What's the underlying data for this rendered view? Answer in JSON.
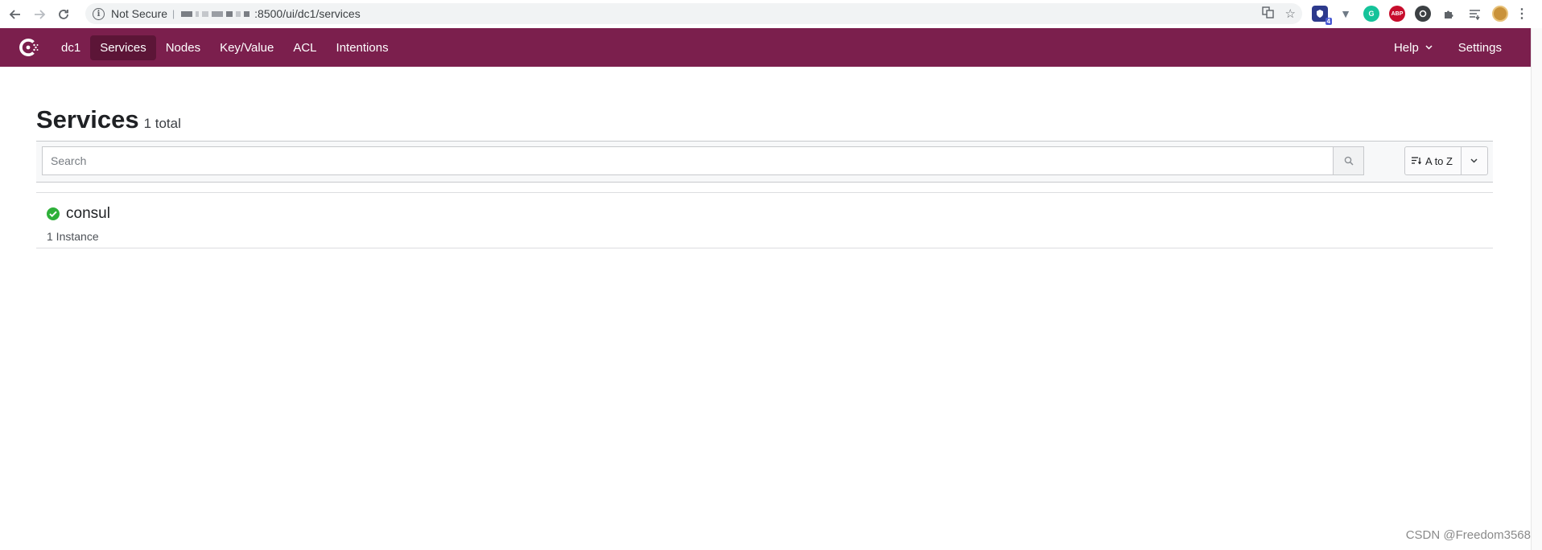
{
  "browser": {
    "security_label": "Not Secure",
    "url_suffix": ":8500/ui/dc1/services",
    "extensions_badge": "4",
    "extension_labels": {
      "grammarly": "G",
      "adblock": "ABP"
    }
  },
  "header": {
    "datacenter": "dc1",
    "nav": [
      {
        "label": "Services",
        "active": true
      },
      {
        "label": "Nodes",
        "active": false
      },
      {
        "label": "Key/Value",
        "active": false
      },
      {
        "label": "ACL",
        "active": false
      },
      {
        "label": "Intentions",
        "active": false
      }
    ],
    "help_label": "Help",
    "settings_label": "Settings",
    "accent_color": "#7b1f4d"
  },
  "main": {
    "title": "Services",
    "total": "1 total",
    "search": {
      "placeholder": "Search",
      "value": ""
    },
    "sort_label": "A to Z",
    "services": [
      {
        "name": "consul",
        "instances": "1 Instance",
        "status": "passing",
        "status_color": "#2eb039"
      }
    ]
  },
  "watermark": "CSDN @Freedom3568"
}
